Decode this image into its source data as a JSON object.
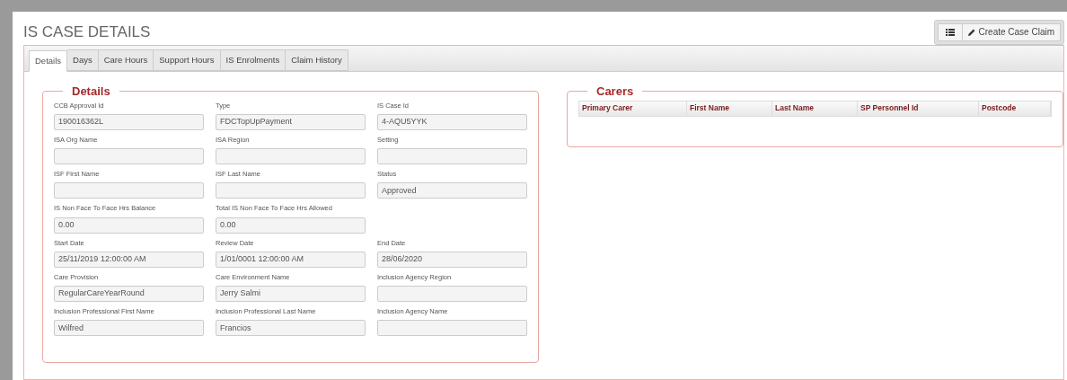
{
  "page_title": "IS CASE DETAILS",
  "toolbar": {
    "create_button": "Create Case Claim"
  },
  "tabs": [
    {
      "label": "Details",
      "selected": true
    },
    {
      "label": "Days",
      "selected": false
    },
    {
      "label": "Care Hours",
      "selected": false
    },
    {
      "label": "Support Hours",
      "selected": false
    },
    {
      "label": "IS Enrolments",
      "selected": false
    },
    {
      "label": "Claim History",
      "selected": false
    }
  ],
  "details": {
    "legend": "Details",
    "rows": [
      [
        {
          "label": "CCB Approval Id",
          "value": "190016362L"
        },
        {
          "label": "Type",
          "value": "FDCTopUpPayment"
        },
        {
          "label": "IS Case Id",
          "value": "4-AQU5YYK"
        }
      ],
      [
        {
          "label": "ISA Org Name"
        },
        {
          "label": "ISA Region"
        },
        {
          "label": "Setting"
        }
      ],
      [
        {
          "label": "ISF First Name"
        },
        {
          "label": "ISF Last Name"
        },
        {
          "label": "Status",
          "value": "Approved"
        }
      ],
      [
        {
          "label": "IS Non Face To Face Hrs Balance",
          "value": "0.00"
        },
        {
          "label": "Total IS Non Face To Face Hrs Allowed",
          "value": "0.00"
        }
      ],
      [
        {
          "label": "Start Date",
          "value": "25/11/2019 12:00:00 AM"
        },
        {
          "label": "Review Date",
          "value": "1/01/0001 12:00:00 AM"
        },
        {
          "label": "End Date",
          "value": "28/06/2020"
        }
      ],
      [
        {
          "label": "Care Provision",
          "value": "RegularCareYearRound"
        },
        {
          "label": "Care Environment Name",
          "value": "Jerry Salmi"
        },
        {
          "label": "Inclusion Agency Region"
        }
      ],
      [
        {
          "label": "Inclusion Professional First Name",
          "value": "Wilfred"
        },
        {
          "label": "Inclusion Professional Last Name",
          "value": "Francios"
        },
        {
          "label": "Inclusion Agency Name"
        }
      ]
    ]
  },
  "carers": {
    "legend": "Carers",
    "columns": [
      "Primary Carer",
      "First Name",
      "Last Name",
      "SP Personnel Id",
      "Postcode"
    ]
  }
}
